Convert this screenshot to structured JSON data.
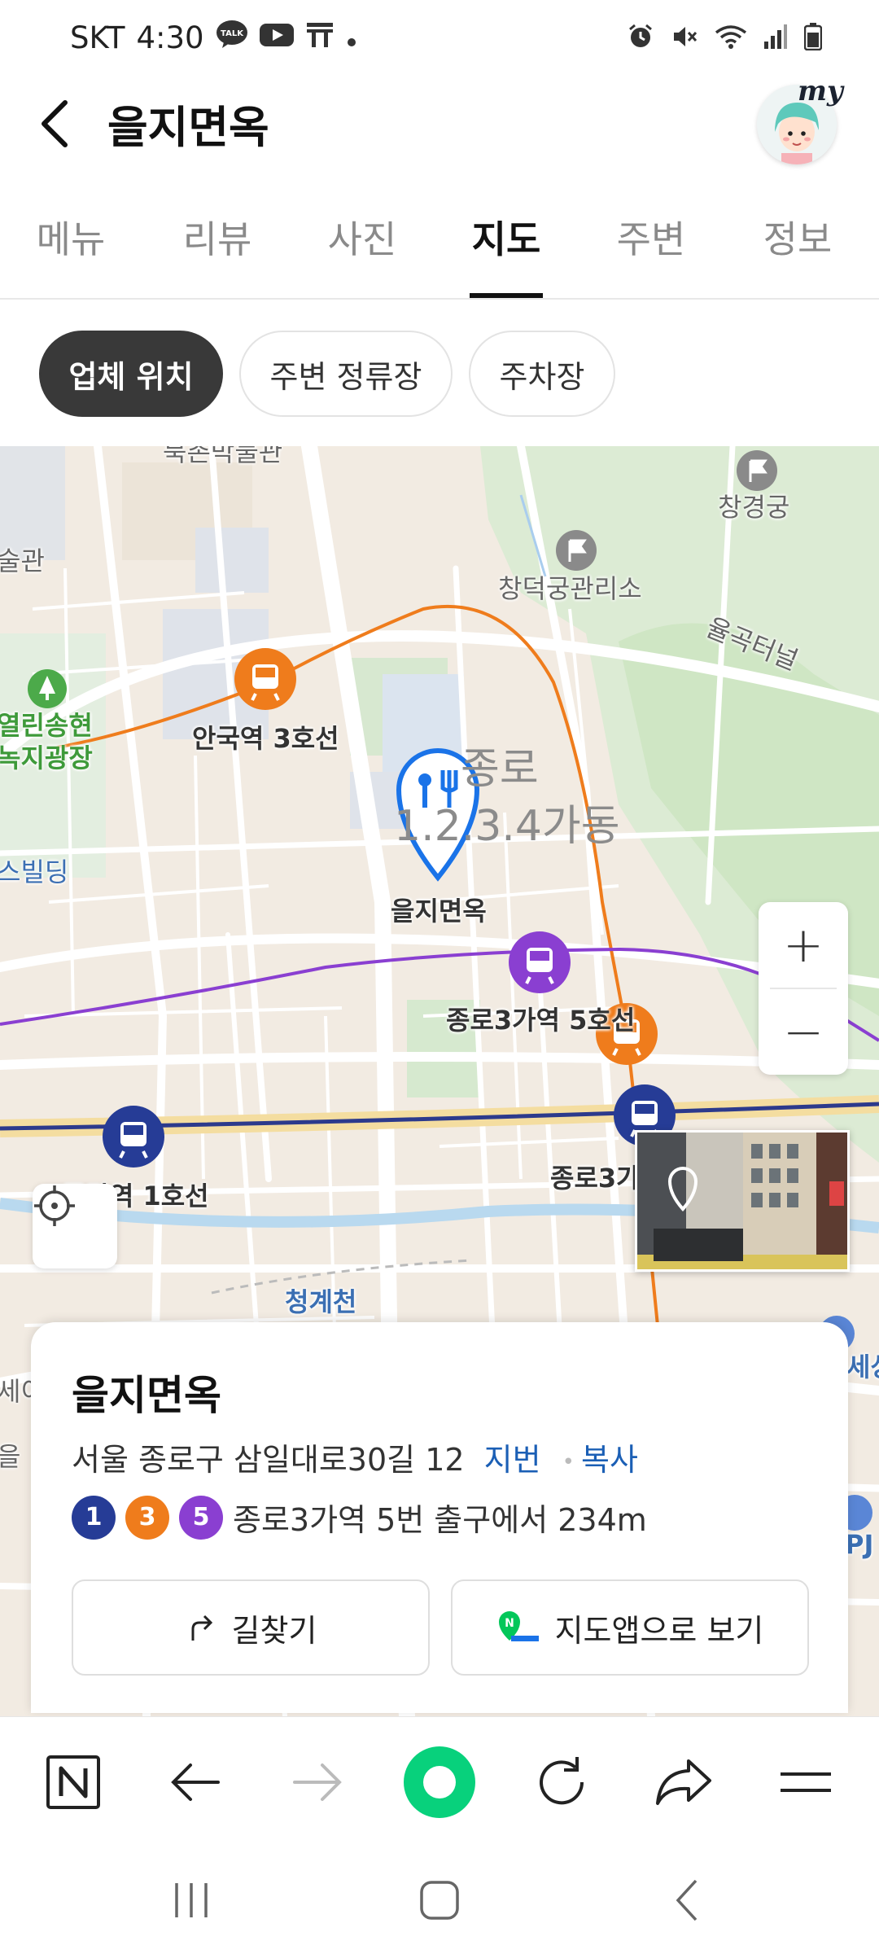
{
  "status_bar": {
    "carrier": "SKT",
    "time": "4:30",
    "icons_left": [
      "talk-icon",
      "youtube-icon",
      "t-icon",
      "dot-icon"
    ],
    "icons_right": [
      "alarm-icon",
      "mute-icon",
      "wifi-icon",
      "signal-icon",
      "battery-icon"
    ]
  },
  "header": {
    "title": "을지면옥",
    "avatar_badge": "my"
  },
  "tabs": [
    {
      "label": "메뉴",
      "active": false
    },
    {
      "label": "리뷰",
      "active": false
    },
    {
      "label": "사진",
      "active": false
    },
    {
      "label": "지도",
      "active": true
    },
    {
      "label": "주변",
      "active": false
    },
    {
      "label": "정보",
      "active": false
    }
  ],
  "chips": [
    {
      "label": "업체 위치",
      "active": true
    },
    {
      "label": "주변 정류장",
      "active": false
    },
    {
      "label": "주차장",
      "active": false
    }
  ],
  "map": {
    "labels": {
      "top_cut": "북촌박물관",
      "changgyeonggung": "창경궁",
      "changdeokgung_office": "창덕궁관리소",
      "yulgok_tunnel": "율곡터널",
      "gwan_cut": "술관",
      "park_line1": "열린송현",
      "park_line2": "녹지광장",
      "building_cut": "스빌딩",
      "anguk_station": "안국역 3호선",
      "district_line1": "종로",
      "district_line2": "1.2.3.4가동",
      "pin_name": "을지면옥",
      "jongno3_line5": "종로3가역 5호선",
      "jongno_line1": "종각역 1호선",
      "jongno3_cut": "종로3가",
      "cheonggyecheon": "청계천",
      "left_cut_1": "세이",
      "left_cut_2": "을",
      "right_cut_1": "세상",
      "right_cut_2": "PJ"
    },
    "zoom_in": "+",
    "zoom_out": "−"
  },
  "place_card": {
    "name": "을지면옥",
    "address": "서울 종로구 삼일대로30길 12",
    "jibun_link": "지번",
    "copy_link": "복사",
    "subway_lines": [
      {
        "num": "1",
        "color": "#263c96"
      },
      {
        "num": "3",
        "color": "#ef7c1c"
      },
      {
        "num": "5",
        "color": "#996cac"
      }
    ],
    "subway_text": "종로3가역 5번 출구에서 234m",
    "directions_label": "길찾기",
    "map_app_label": "지도앱으로 보기"
  },
  "colors": {
    "line1": "#263c96",
    "line3": "#ef7c1c",
    "line5": "#8a3fd1",
    "pin_blue": "#1a73e8",
    "link_blue": "#1b5fb5",
    "naver_green": "#03c75a"
  }
}
